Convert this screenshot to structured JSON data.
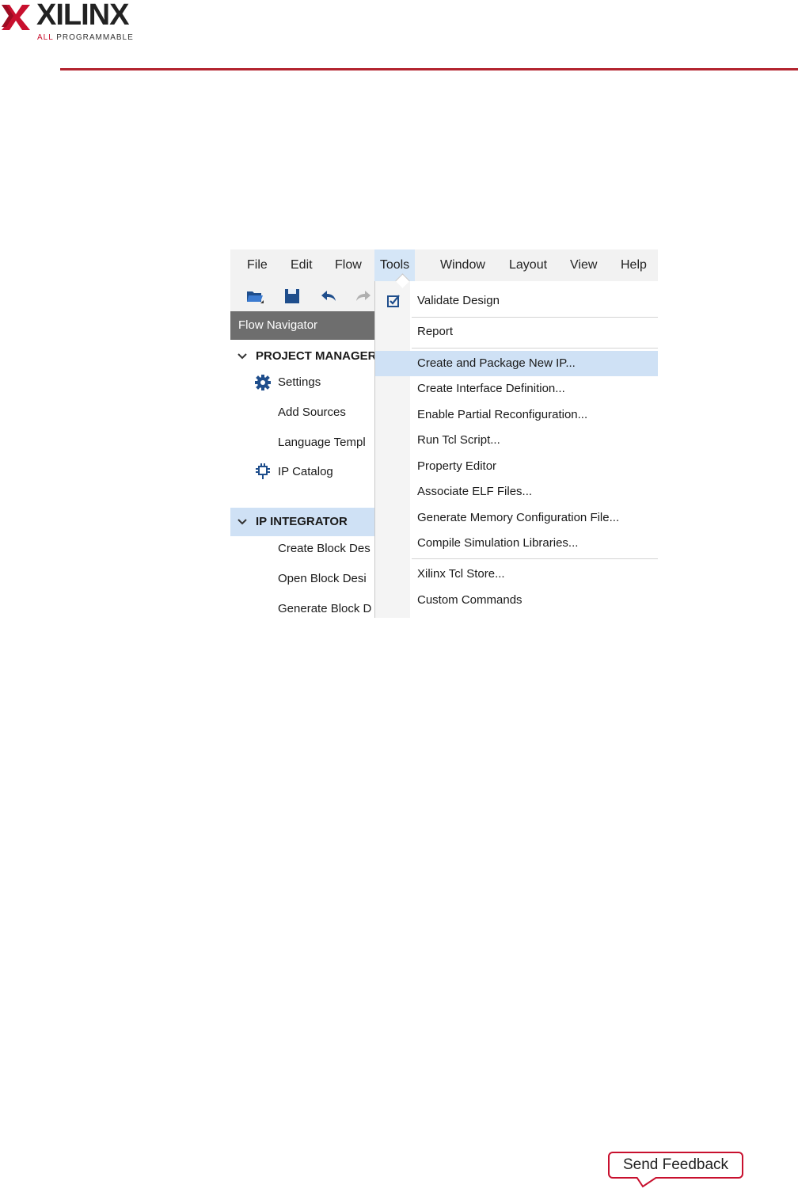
{
  "header": {
    "logo_word": "XILINX",
    "logo_tag_all": "ALL",
    "logo_tag_rest": "PROGRAMMABLE",
    "brand_color": "#c8102e"
  },
  "menubar": {
    "items": [
      {
        "label": "File",
        "underline": "F"
      },
      {
        "label": "Edit",
        "underline": "E"
      },
      {
        "label": "Flow",
        "underline": "l"
      },
      {
        "label": "Tools",
        "underline": "T",
        "active": true
      },
      {
        "label": "Window",
        "underline": "W"
      },
      {
        "label": "Layout",
        "underline": "y"
      },
      {
        "label": "View",
        "underline": "V"
      },
      {
        "label": "Help",
        "underline": "H"
      }
    ]
  },
  "toolbar": {
    "icons": [
      "open-folder-icon",
      "save-icon",
      "undo-icon",
      "redo-icon"
    ]
  },
  "flow_navigator": {
    "title": "Flow Navigator",
    "project_manager": {
      "label": "PROJECT MANAGER",
      "items": [
        {
          "label": "Settings",
          "icon": "gear-icon"
        },
        {
          "label": "Add Sources"
        },
        {
          "label": "Language Templ"
        },
        {
          "label": "IP Catalog",
          "icon": "ip-catalog-icon"
        }
      ]
    },
    "ip_integrator": {
      "label": "IP INTEGRATOR",
      "items": [
        {
          "label": "Create Block Des"
        },
        {
          "label": "Open Block Desi"
        },
        {
          "label": "Generate Block D"
        }
      ]
    }
  },
  "tools_menu": {
    "items": [
      {
        "label": "Validate Design",
        "icon": "validate-check-icon"
      },
      {
        "label": "Report"
      },
      {
        "label": "Create and Package New IP...",
        "highlighted": true
      },
      {
        "label": "Create Interface Definition..."
      },
      {
        "label": "Enable Partial Reconfiguration..."
      },
      {
        "label": "Run Tcl Script..."
      },
      {
        "label": "Property Editor"
      },
      {
        "label": "Associate ELF Files..."
      },
      {
        "label": "Generate Memory Configuration File..."
      },
      {
        "label": "Compile Simulation Libraries..."
      },
      {
        "label": "Xilinx Tcl Store..."
      },
      {
        "label": "Custom Commands"
      }
    ]
  },
  "feedback": {
    "label": "Send Feedback"
  },
  "colors": {
    "header_rule": "#b3242f",
    "menu_highlight": "#cfe1f5",
    "flow_nav_header_bg": "#6e6e6e"
  }
}
